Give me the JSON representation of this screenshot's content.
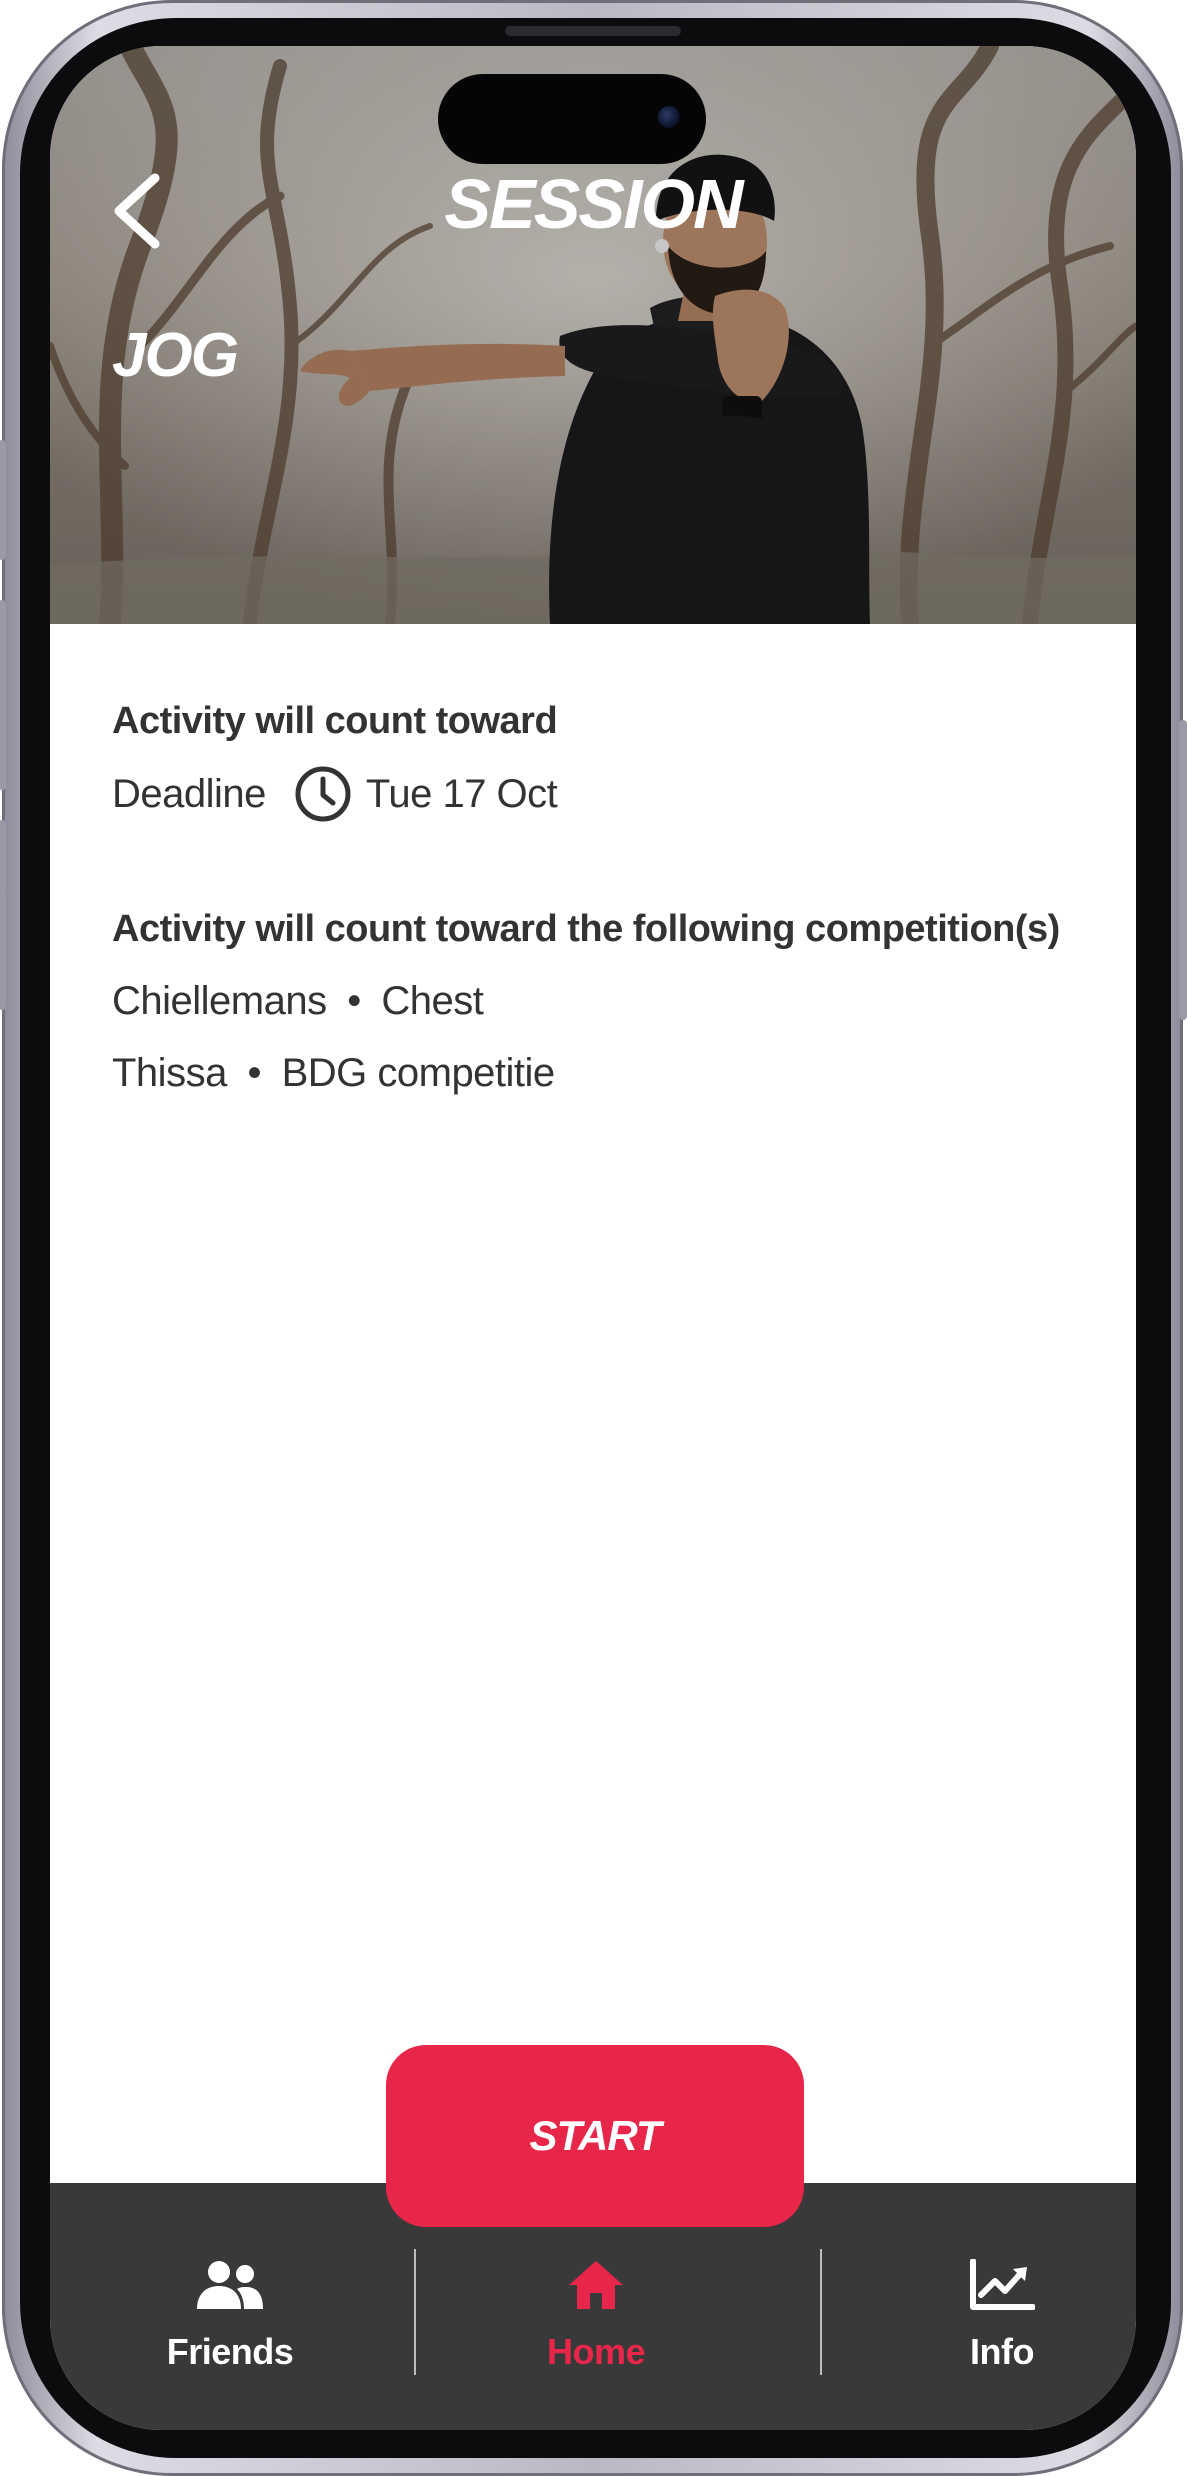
{
  "header": {
    "title": "SESSION",
    "activity_name": "JOG"
  },
  "target": {
    "heading": "Activity will count toward",
    "deadline_label": "Deadline",
    "deadline_date": "Tue 17 Oct"
  },
  "competitions": {
    "heading": "Activity will count toward the following competition(s)",
    "items": [
      {
        "name": "Chiellemans",
        "category": "Chest"
      },
      {
        "name": "Thissa",
        "category": "BDG competitie"
      }
    ],
    "separator": "•"
  },
  "actions": {
    "start_label": "START"
  },
  "bottom_nav": {
    "items": [
      {
        "label": "Friends",
        "icon": "friends-icon"
      },
      {
        "label": "Home",
        "icon": "home-icon",
        "active": true
      },
      {
        "label": "Info",
        "icon": "chart-icon"
      }
    ]
  },
  "colors": {
    "accent": "#e8264a",
    "nav_background": "#393939",
    "text": "#333333"
  }
}
